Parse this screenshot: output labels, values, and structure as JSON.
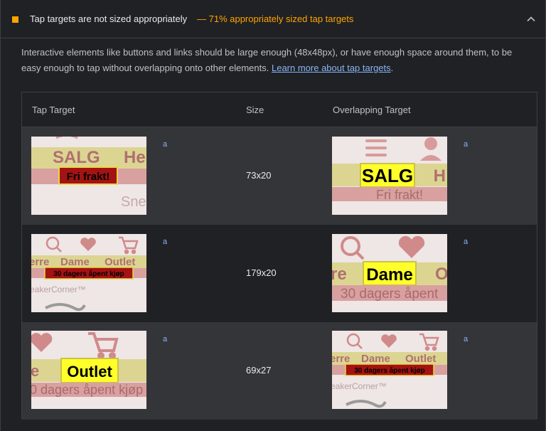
{
  "audit": {
    "title": "Tap targets are not sized appropriately",
    "display_value": "— 71% appropriately sized tap targets",
    "status_color": "#ffa400",
    "description": "Interactive elements like buttons and links should be large enough (48x48px), or have enough space around them, to be easy enough to tap without overlapping onto other elements.",
    "learn_more": "Learn more about tap targets",
    "learn_more_suffix": ".",
    "chevron_icon": "chevron-up-icon"
  },
  "table": {
    "headers": {
      "tap_target": "Tap Target",
      "size": "Size",
      "overlapping": "Overlapping Target"
    },
    "rows": [
      {
        "tap_label": "a",
        "size": "73x20",
        "overlap_label": "a",
        "tap_thumb": {
          "highlight": "Fri frakt!",
          "nav_1": "SALG",
          "nav_2": "He",
          "sub": "Sne"
        },
        "overlap_thumb": {
          "highlight": "SALG",
          "right_text": "H",
          "sub": "Fri frakt!"
        }
      },
      {
        "tap_label": "a",
        "size": "179x20",
        "overlap_label": "a",
        "tap_thumb": {
          "highlight": "30 dagers åpent kjøp",
          "nav_0": "erre",
          "nav_1": "Dame",
          "nav_2": "Outlet",
          "sub": "eakerCorner™"
        },
        "overlap_thumb": {
          "highlight": "Dame",
          "left_text": "re",
          "right_text": "O",
          "sub": "30 dagers åpent"
        }
      },
      {
        "tap_label": "a",
        "size": "69x27",
        "overlap_label": "a",
        "tap_thumb": {
          "highlight": "Outlet",
          "left_text": "e",
          "sub": "0 dagers åpent kjøp"
        },
        "overlap_thumb": {
          "highlight": "30 dagers åpent kjøp",
          "nav_0": "erre",
          "nav_1": "Dame",
          "nav_2": "Outlet",
          "sub": "eakerCorner™"
        }
      }
    ]
  }
}
